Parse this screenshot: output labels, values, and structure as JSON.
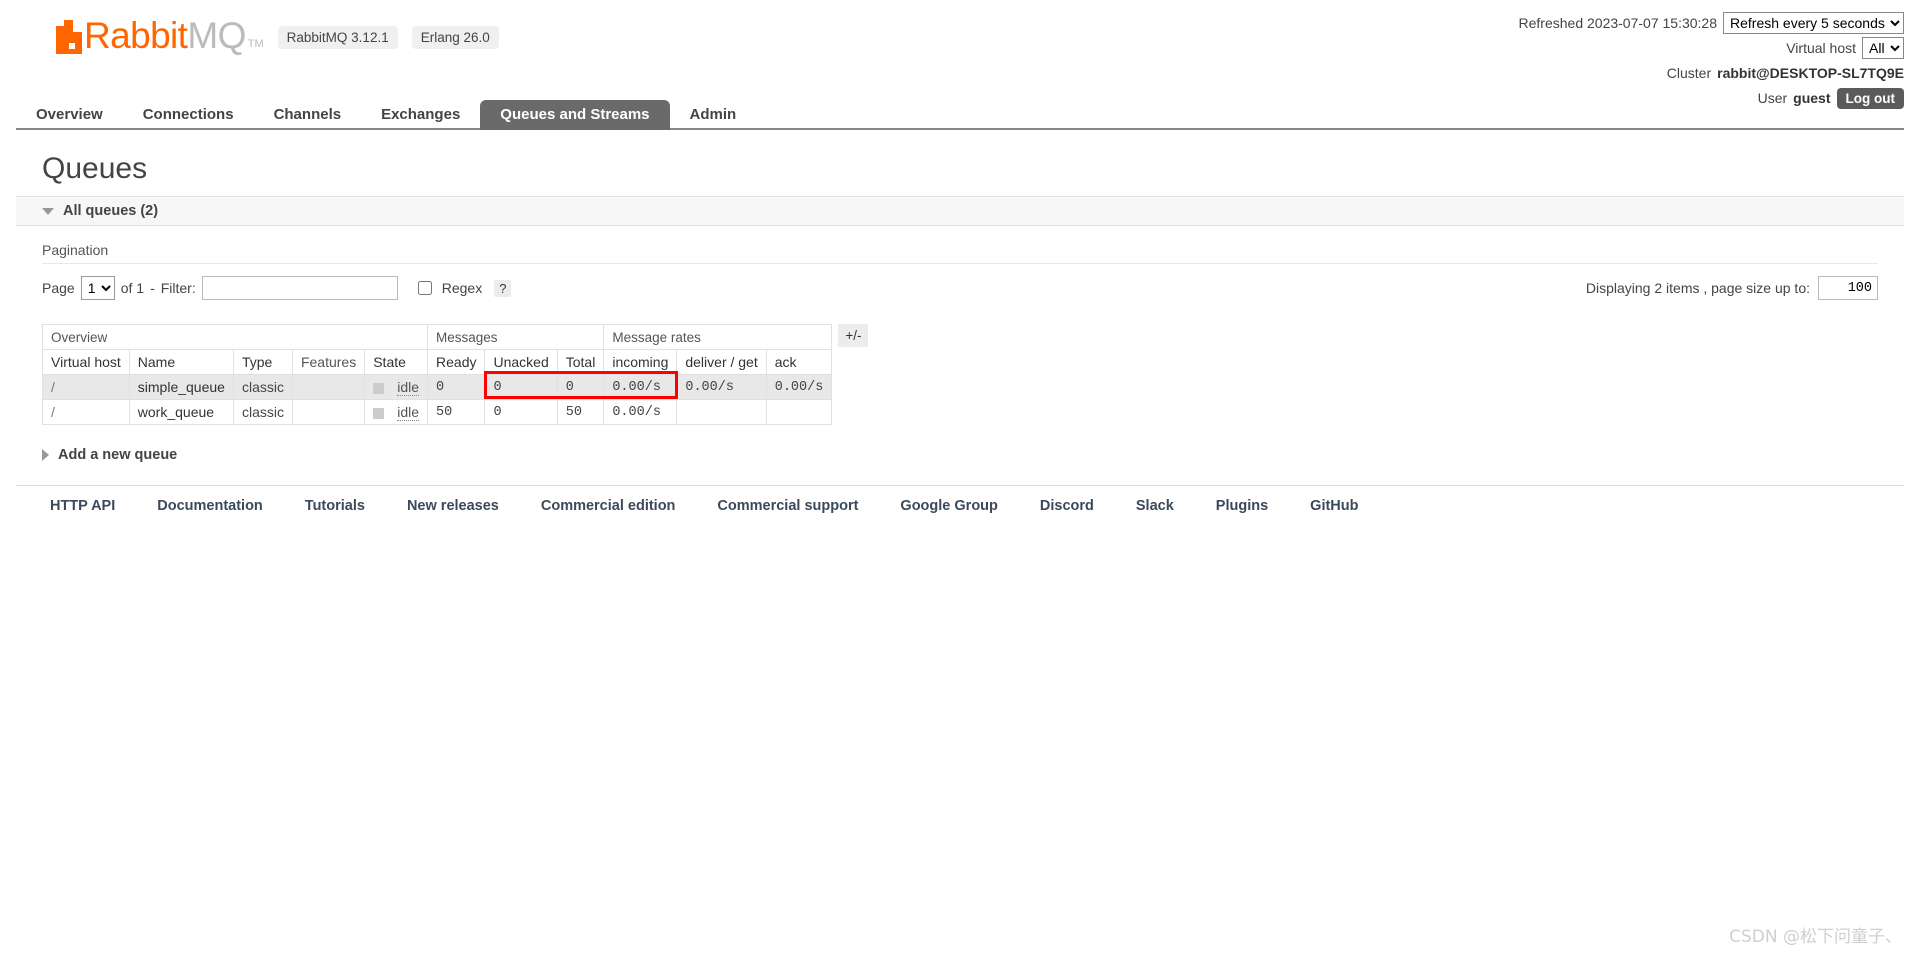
{
  "brand": {
    "name_part1": "Rabbit",
    "name_part2": "MQ",
    "tm": "TM",
    "logo_color": "#ff6600",
    "versions": [
      "RabbitMQ 3.12.1",
      "Erlang 26.0"
    ]
  },
  "header": {
    "refreshed_label": "Refreshed 2023-07-07 15:30:28",
    "refresh_select_value": "Refresh every 5 seconds",
    "refresh_options": [
      "Refresh every 5 seconds"
    ],
    "vhost_label": "Virtual host",
    "vhost_value": "All",
    "vhost_options": [
      "All"
    ],
    "cluster_label": "Cluster",
    "cluster_value": "rabbit@DESKTOP-SL7TQ9E",
    "user_label": "User",
    "user_value": "guest",
    "logout_label": "Log out"
  },
  "nav": {
    "tabs": [
      {
        "label": "Overview",
        "active": false
      },
      {
        "label": "Connections",
        "active": false
      },
      {
        "label": "Channels",
        "active": false
      },
      {
        "label": "Exchanges",
        "active": false
      },
      {
        "label": "Queues and Streams",
        "active": true
      },
      {
        "label": "Admin",
        "active": false
      }
    ]
  },
  "page": {
    "title": "Queues",
    "section_title": "All queues (2)",
    "pagination_label": "Pagination"
  },
  "pagination": {
    "page_label": "Page",
    "page_value": "1",
    "page_options": [
      "1"
    ],
    "of_label": "of 1",
    "dash": "-",
    "filter_label": "Filter:",
    "filter_value": "",
    "filter_placeholder": "",
    "regex_label": "Regex",
    "regex_checked": false,
    "help_label": "?",
    "displaying_label": "Displaying 2 items , page size up to:",
    "page_size_value": "100"
  },
  "table": {
    "group_headers": [
      {
        "label": "Overview",
        "span": 5
      },
      {
        "label": "Messages",
        "span": 3
      },
      {
        "label": "Message rates",
        "span": 3
      }
    ],
    "columns": [
      {
        "label": "Virtual host",
        "bold": true,
        "align": "left"
      },
      {
        "label": "Name",
        "bold": true,
        "align": "left"
      },
      {
        "label": "Type",
        "bold": true,
        "align": "left"
      },
      {
        "label": "Features",
        "bold": false,
        "align": "left"
      },
      {
        "label": "State",
        "bold": true,
        "align": "left"
      },
      {
        "label": "Ready",
        "bold": true,
        "align": "left"
      },
      {
        "label": "Unacked",
        "bold": true,
        "align": "left"
      },
      {
        "label": "Total",
        "bold": true,
        "align": "left"
      },
      {
        "label": "incoming",
        "bold": true,
        "align": "left"
      },
      {
        "label": "deliver / get",
        "bold": true,
        "align": "left"
      },
      {
        "label": "ack",
        "bold": true,
        "align": "left"
      }
    ],
    "rows": [
      {
        "vhost": "/",
        "name": "simple_queue",
        "type": "classic",
        "features": "",
        "state": "idle",
        "ready": "0",
        "unacked": "0",
        "total": "0",
        "incoming": "0.00/s",
        "deliver_get": "0.00/s",
        "ack": "0.00/s"
      },
      {
        "vhost": "/",
        "name": "work_queue",
        "type": "classic",
        "features": "",
        "state": "idle",
        "ready": "50",
        "unacked": "0",
        "total": "50",
        "incoming": "0.00/s",
        "deliver_get": "",
        "ack": ""
      }
    ],
    "columns_toggle_label": "+/-",
    "highlight_color": "#ff0000"
  },
  "add_queue": {
    "label": "Add a new queue"
  },
  "footer": {
    "links": [
      "HTTP API",
      "Documentation",
      "Tutorials",
      "New releases",
      "Commercial edition",
      "Commercial support",
      "Google Group",
      "Discord",
      "Slack",
      "Plugins",
      "GitHub"
    ]
  },
  "watermark": {
    "text": "CSDN @松下问童子、"
  }
}
